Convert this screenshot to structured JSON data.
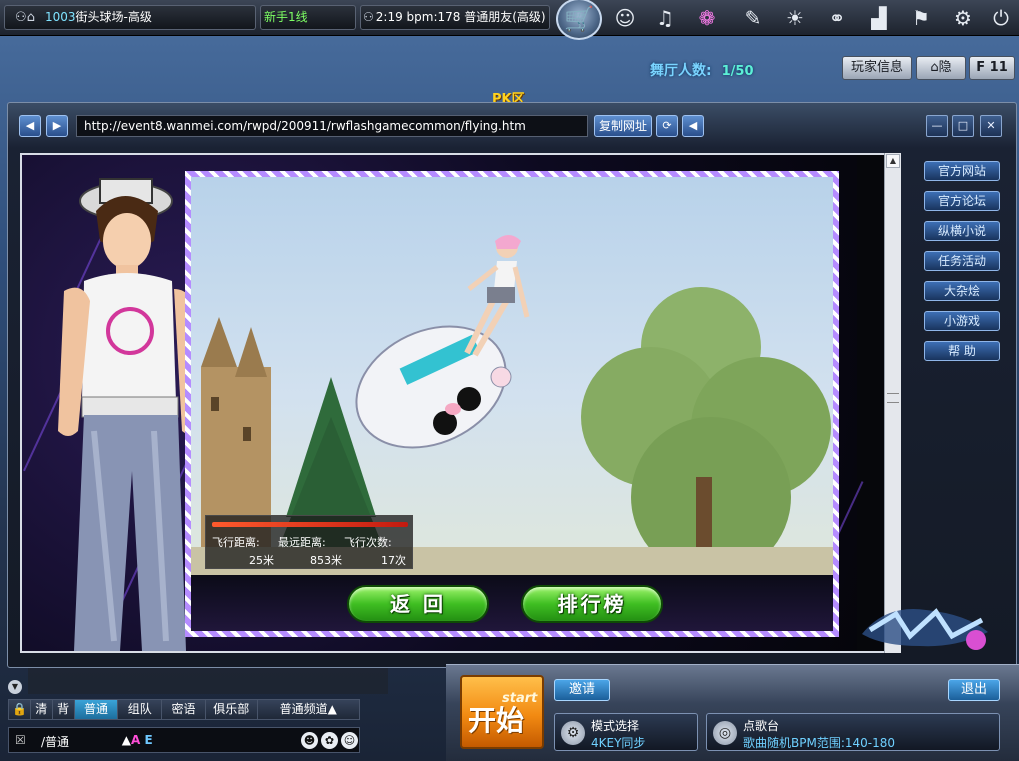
{
  "topbar": {
    "room_num": "1003",
    "room_name": "街头球场-高级",
    "line": "新手1线",
    "status": "2:19 bpm:178 普通朋友(高级)",
    "icons": [
      "cart-icon",
      "avatar-icon",
      "music-box-icon",
      "club-icon",
      "chat-bubble-icon",
      "dance-figure-icon",
      "couple-icon",
      "stairs-icon",
      "flag-icon",
      "gear-icon",
      "power-icon"
    ]
  },
  "room": {
    "dance_label": "舞厅人数:",
    "dance_count": "1/50",
    "player_info": "玩家信息",
    "hide": "隐",
    "f11": "F 11",
    "pk_label": "PK区"
  },
  "browser": {
    "url": "http://event8.wanmei.com/rwpd/200911/rwflashgamecommon/flying.htm",
    "copy_url": "复制网址"
  },
  "game": {
    "return_btn": "返 回",
    "rank_btn": "排行榜",
    "score": {
      "dist_label": "飞行距离:",
      "dist_value": "25米",
      "far_label": "最远距离:",
      "far_value": "853米",
      "count_label": "飞行次数:",
      "count_value": "17次"
    }
  },
  "sidebar": {
    "items": [
      "官方网站",
      "官方论坛",
      "纵横小说",
      "任务活动",
      "大杂烩",
      "小游戏",
      "帮 助"
    ]
  },
  "chat": {
    "tabs": [
      "清",
      "背",
      "普通",
      "组队",
      "密语",
      "俱乐部",
      "普通频道▲"
    ],
    "active_tab": "普通",
    "channel_select": "/普通",
    "ae_a": "A",
    "ae_e": "E"
  },
  "control": {
    "start_big": "开始",
    "start_small": "start",
    "invite": "邀请",
    "exit": "退出",
    "mode_title": "模式选择",
    "mode_value": "4KEY同步",
    "song_title": "点歌台",
    "song_value": "歌曲随机BPM范围:140-180"
  },
  "colors": {
    "accent": "#3aa3d8",
    "start": "#f28a12",
    "green_button": "#3fbe22",
    "frame_stripe": "#b58cff"
  }
}
